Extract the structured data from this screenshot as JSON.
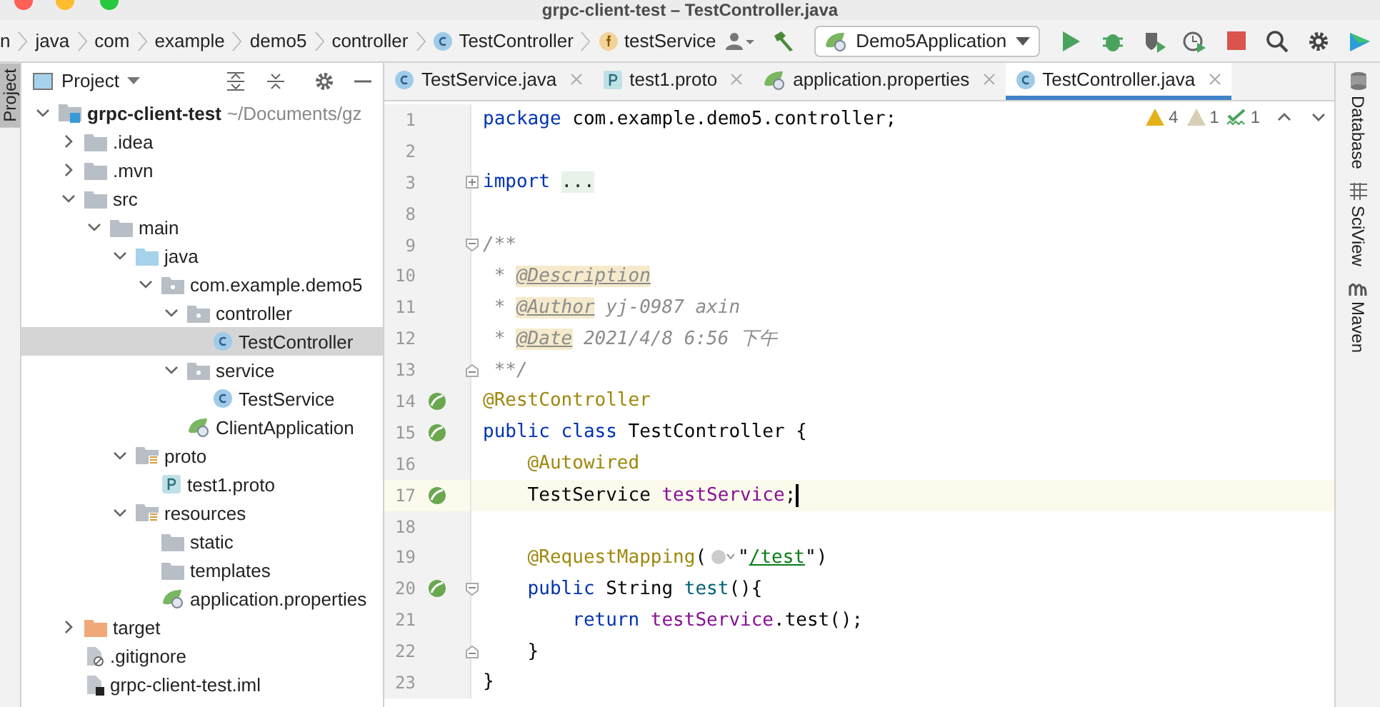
{
  "window": {
    "title": "grpc-client-test – TestController.java"
  },
  "breadcrumbs": [
    {
      "label": "n",
      "kind": "plain"
    },
    {
      "label": "java",
      "kind": "plain"
    },
    {
      "label": "com",
      "kind": "plain"
    },
    {
      "label": "example",
      "kind": "plain"
    },
    {
      "label": "demo5",
      "kind": "plain"
    },
    {
      "label": "controller",
      "kind": "plain"
    },
    {
      "label": "TestController",
      "kind": "class"
    },
    {
      "label": "testService",
      "kind": "field"
    }
  ],
  "run_config": {
    "label": "Demo5Application"
  },
  "left_strip": [
    {
      "label": "Project",
      "selected": true
    }
  ],
  "project_panel": {
    "title": "Project"
  },
  "tree": [
    {
      "label": "grpc-client-test",
      "hint": "~/Documents/gz",
      "kind": "module",
      "expanded": true,
      "selected": false,
      "children": [
        {
          "label": ".idea",
          "kind": "folder",
          "expanded": false,
          "selected": false
        },
        {
          "label": ".mvn",
          "kind": "folder",
          "expanded": false,
          "selected": false
        },
        {
          "label": "src",
          "kind": "folder",
          "expanded": true,
          "selected": false,
          "children": [
            {
              "label": "main",
              "kind": "folder",
              "expanded": true,
              "selected": false,
              "children": [
                {
                  "label": "java",
                  "kind": "source",
                  "expanded": true,
                  "selected": false,
                  "children": [
                    {
                      "label": "com.example.demo5",
                      "kind": "package",
                      "expanded": true,
                      "selected": false,
                      "children": [
                        {
                          "label": "controller",
                          "kind": "package",
                          "expanded": true,
                          "selected": false,
                          "children": [
                            {
                              "label": "TestController",
                              "kind": "class",
                              "selected": true
                            }
                          ]
                        },
                        {
                          "label": "service",
                          "kind": "package",
                          "expanded": true,
                          "selected": false,
                          "children": [
                            {
                              "label": "TestService",
                              "kind": "class",
                              "selected": false
                            }
                          ]
                        },
                        {
                          "label": "ClientApplication",
                          "kind": "app",
                          "selected": false
                        }
                      ]
                    }
                  ]
                },
                {
                  "label": "proto",
                  "kind": "resource",
                  "expanded": true,
                  "selected": false,
                  "children": [
                    {
                      "label": "test1.proto",
                      "kind": "proto",
                      "selected": false
                    }
                  ]
                },
                {
                  "label": "resources",
                  "kind": "resource",
                  "expanded": true,
                  "selected": false,
                  "children": [
                    {
                      "label": "static",
                      "kind": "folder",
                      "selected": false
                    },
                    {
                      "label": "templates",
                      "kind": "folder",
                      "selected": false
                    },
                    {
                      "label": "application.properties",
                      "kind": "spring",
                      "selected": false
                    }
                  ]
                }
              ]
            }
          ]
        },
        {
          "label": "target",
          "kind": "excluded",
          "expanded": false,
          "selected": false
        },
        {
          "label": ".gitignore",
          "kind": "ignore",
          "selected": false
        },
        {
          "label": "grpc-client-test.iml",
          "kind": "iml",
          "selected": false
        }
      ]
    }
  ],
  "tabs": [
    {
      "label": "TestService.java",
      "kind": "class",
      "selected": false
    },
    {
      "label": "test1.proto",
      "kind": "proto",
      "selected": false
    },
    {
      "label": "application.properties",
      "kind": "spring",
      "selected": false
    },
    {
      "label": "TestController.java",
      "kind": "class",
      "selected": true
    }
  ],
  "inspections": [
    {
      "kind": "warning",
      "count": "4"
    },
    {
      "kind": "weak",
      "count": "1"
    },
    {
      "kind": "typo",
      "count": "1"
    }
  ],
  "code": [
    {
      "number": "1",
      "current": false,
      "tokens": [
        {
          "kind": "keyword",
          "text": "package"
        },
        {
          "kind": "plain",
          "text": " com.example.demo5.controller;"
        }
      ]
    },
    {
      "number": "2",
      "current": false
    },
    {
      "number": "3",
      "current": false,
      "fold_marker": {
        "kind": "plus"
      },
      "tokens": [
        {
          "kind": "keyword",
          "text": "import "
        },
        {
          "kind": "folded",
          "text": "..."
        }
      ]
    },
    {
      "number": "8",
      "current": false
    },
    {
      "number": "9",
      "current": false,
      "fold_marker": {
        "kind": "open"
      },
      "tokens": [
        {
          "kind": "comment",
          "text": "/**"
        }
      ]
    },
    {
      "number": "10",
      "current": false,
      "tokens": [
        {
          "kind": "comment",
          "text": " * "
        },
        {
          "kind": "doctag",
          "text": "@Description"
        }
      ]
    },
    {
      "number": "11",
      "current": false,
      "tokens": [
        {
          "kind": "comment",
          "text": " * "
        },
        {
          "kind": "doctag",
          "text": "@Author"
        },
        {
          "kind": "comment",
          "text": " yj-0987 axin"
        }
      ]
    },
    {
      "number": "12",
      "current": false,
      "tokens": [
        {
          "kind": "comment",
          "text": " * "
        },
        {
          "kind": "doctag",
          "text": "@Date"
        },
        {
          "kind": "comment",
          "text": " 2021/4/8 6:56 下午"
        }
      ]
    },
    {
      "number": "13",
      "current": false,
      "fold_marker": {
        "kind": "close"
      },
      "tokens": [
        {
          "kind": "comment",
          "text": " **/"
        }
      ]
    },
    {
      "number": "14",
      "current": false,
      "gutter_icon": {
        "kind": "bean"
      },
      "tokens": [
        {
          "kind": "annotation",
          "text": "@RestController"
        }
      ]
    },
    {
      "number": "15",
      "current": false,
      "gutter_icon": {
        "kind": "bean"
      },
      "tokens": [
        {
          "kind": "keyword",
          "text": "public class"
        },
        {
          "kind": "plain",
          "text": " TestController {"
        }
      ]
    },
    {
      "number": "16",
      "current": false,
      "tokens": [
        {
          "kind": "annotation",
          "text": "    @Autowired"
        }
      ]
    },
    {
      "number": "17",
      "current": true,
      "gutter_icon": {
        "kind": "bean"
      },
      "tokens": [
        {
          "kind": "plain",
          "text": "    TestService "
        },
        {
          "kind": "field",
          "text": "testService"
        },
        {
          "kind": "plain",
          "text": ";"
        }
      ]
    },
    {
      "number": "18",
      "current": false
    },
    {
      "number": "19",
      "current": false,
      "tokens": [
        {
          "kind": "annotation",
          "text": "    @RequestMapping"
        },
        {
          "kind": "plain",
          "text": "("
        },
        {
          "kind": "inlay"
        },
        {
          "kind": "plain",
          "text": "\""
        },
        {
          "kind": "link",
          "text": "/test"
        },
        {
          "kind": "plain",
          "text": "\")"
        }
      ]
    },
    {
      "number": "20",
      "current": false,
      "gutter_icon": {
        "kind": "bean"
      },
      "fold_marker": {
        "kind": "open"
      },
      "tokens": [
        {
          "kind": "keyword",
          "text": "    public"
        },
        {
          "kind": "plain",
          "text": " String "
        },
        {
          "kind": "method",
          "text": "test"
        },
        {
          "kind": "plain",
          "text": "(){"
        }
      ]
    },
    {
      "number": "21",
      "current": false,
      "tokens": [
        {
          "kind": "keyword",
          "text": "        return"
        },
        {
          "kind": "field",
          "text": " testService"
        },
        {
          "kind": "plain",
          "text": ".test();"
        }
      ]
    },
    {
      "number": "22",
      "current": false,
      "fold_marker": {
        "kind": "close"
      },
      "tokens": [
        {
          "kind": "plain",
          "text": "    }"
        }
      ]
    },
    {
      "number": "23",
      "current": false,
      "tokens": [
        {
          "kind": "plain",
          "text": "}"
        }
      ]
    }
  ],
  "right_strip": [
    {
      "label": "Database",
      "kind": "database"
    },
    {
      "label": "SciView",
      "kind": "sciview"
    },
    {
      "label": "Maven",
      "kind": "maven"
    }
  ]
}
